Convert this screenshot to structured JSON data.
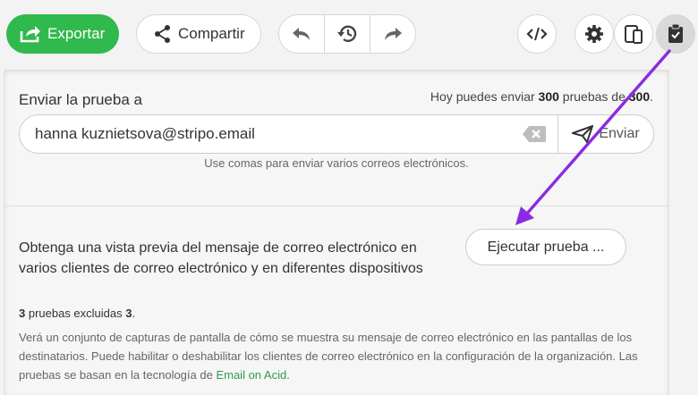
{
  "toolbar": {
    "export_label": "Exportar",
    "share_label": "Compartir",
    "icons": {
      "export": "export-icon",
      "share": "share-icon",
      "undo": "undo-icon",
      "history": "history-icon",
      "redo": "redo-icon",
      "code": "code-icon",
      "settings": "gear-icon",
      "devices": "devices-icon",
      "test": "clipboard-check-icon"
    }
  },
  "test_panel": {
    "send_label": "Enviar la prueba a",
    "limit_prefix": "Hoy puedes enviar ",
    "limit_count": "300",
    "limit_middle": " pruebas de ",
    "limit_total": "300",
    "limit_suffix": ".",
    "email_value": "hanna kuznietsova@stripo.email",
    "send_button": "Enviar",
    "hint": "Use comas para enviar varios correos electrónicos.",
    "preview_title": "Obtenga una vista previa del mensaje de correo electrónico en varios clientes de correo electrónico y en diferentes dispositivos",
    "run_button": "Ejecutar prueba ...",
    "excluded_count": "3",
    "excluded_middle": " pruebas excluidas ",
    "excluded_total": "3",
    "excluded_suffix": ".",
    "description": "Verá un conjunto de capturas de pantalla de cómo se muestra su mensaje de correo electrónico en las pantallas de los destinatarios. Puede habilitar o deshabilitar los clientes de correo electrónico en la configuración de la organización. Las pruebas se basan en la tecnología de ",
    "description_link": "Email on Acid",
    "description_end": "."
  },
  "colors": {
    "brand_green": "#30b94d",
    "annotation_arrow": "#8a2be2",
    "link": "#2e9e48"
  }
}
